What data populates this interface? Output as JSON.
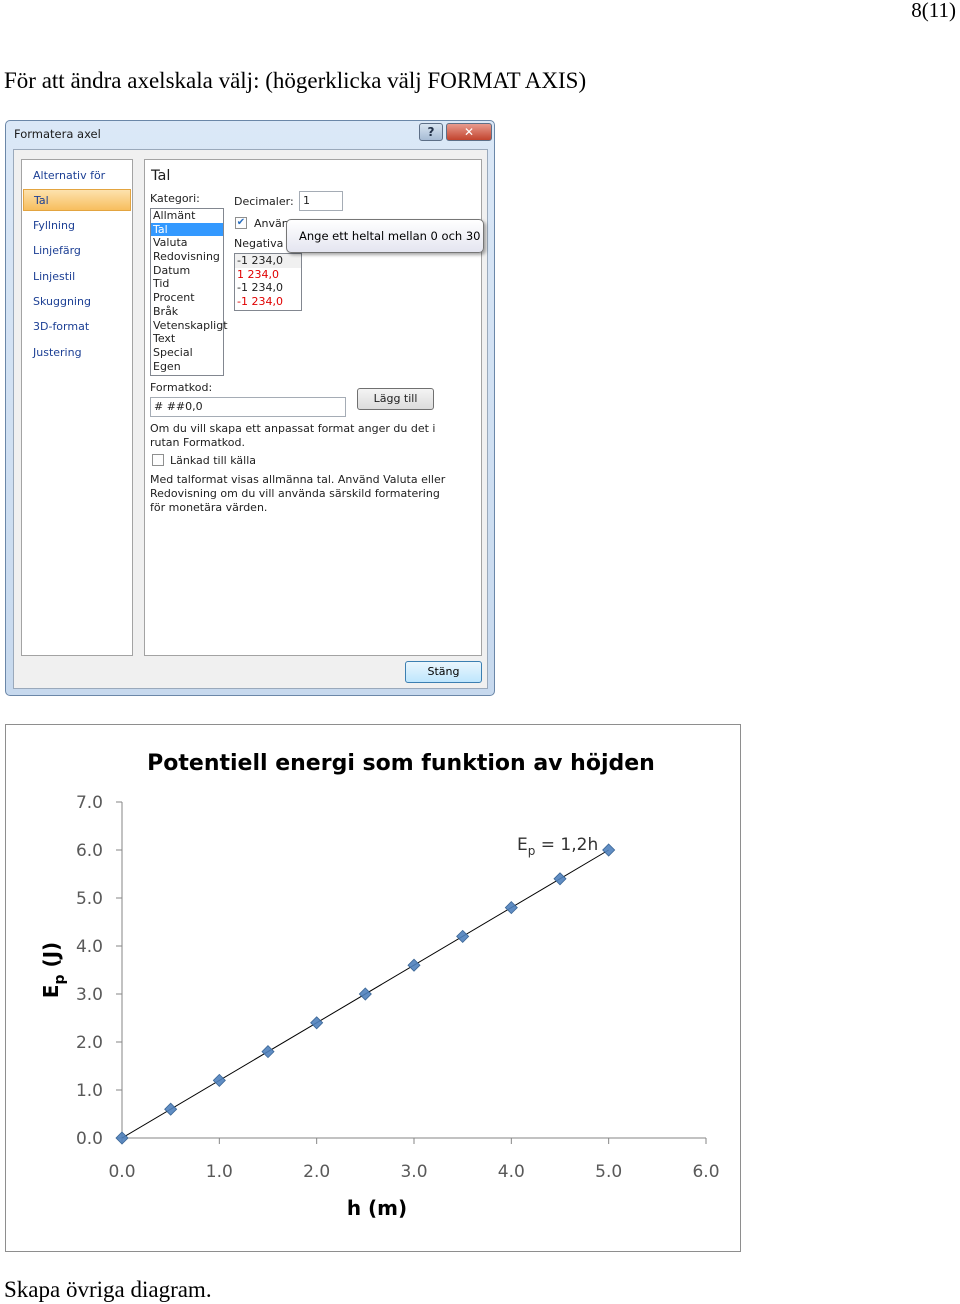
{
  "page_number": "8(11)",
  "intro_text": "För att ändra axelskala välj: (högerklicka välj FORMAT AXIS)",
  "outro_text": "Skapa övriga diagram.",
  "dialog": {
    "title": "Formatera axel",
    "help_icon": "question-icon",
    "close_icon": "close-icon",
    "nav_items": [
      "Alternativ för axel",
      "Tal",
      "Fyllning",
      "Linjefärg",
      "Linjestil",
      "Skuggning",
      "3D-format",
      "Justering"
    ],
    "selected_nav": "Tal",
    "panel_heading": "Tal",
    "kategori_label": "Kategori:",
    "kategori_items": [
      "Allmänt",
      "Tal",
      "Valuta",
      "Redovisning",
      "Datum",
      "Tid",
      "Procent",
      "Bråk",
      "Vetenskapligt",
      "Text",
      "Special",
      "Egen"
    ],
    "kategori_selected": "Tal",
    "decimaler_label": "Decimaler:",
    "decimaler_value": "1",
    "anvand_label": "Använd",
    "anvand_checked": true,
    "negativa_label": "Negativa t",
    "negativa_items": [
      "-1 234,0",
      "1 234,0",
      "-1 234,0",
      "-1 234,0"
    ],
    "tooltip": "Ange ett heltal mellan 0 och 30",
    "formatkod_label": "Formatkod:",
    "formatkod_value": "# ##0,0",
    "lagg_till_button": "Lägg till",
    "hint_text": "Om du vill skapa ett anpassat format anger du det i rutan Formatkod.",
    "lankad_label": "Länkad till källa",
    "lankad_checked": false,
    "info_text": "Med talformat visas allmänna tal. Använd Valuta eller Redovisning om du vill använda särskild formatering för monetära värden.",
    "stang_button": "Stäng"
  },
  "chart_data": {
    "type": "scatter",
    "title": "Potentiell energi som funktion av höjden",
    "xlabel": "h (m)",
    "ylabel": "Ep (J)",
    "ylabel_main": "E",
    "ylabel_sub": "p",
    "ylabel_rest": " (J)",
    "xlim": [
      0,
      6
    ],
    "ylim": [
      0,
      7
    ],
    "x_ticks": [
      "0.0",
      "1.0",
      "2.0",
      "3.0",
      "4.0",
      "5.0",
      "6.0"
    ],
    "y_ticks": [
      "0.0",
      "1.0",
      "2.0",
      "3.0",
      "4.0",
      "5.0",
      "6.0",
      "7.0"
    ],
    "grid": false,
    "marker_color": "#4f81bd",
    "series": [
      {
        "x": [
          0,
          0.5,
          1.0,
          1.5,
          2.0,
          2.5,
          3.0,
          3.5,
          4.0,
          4.5,
          5.0
        ],
        "y": [
          0,
          0.6,
          1.2,
          1.8,
          2.4,
          3.0,
          3.6,
          4.2,
          4.8,
          5.4,
          6.0
        ]
      }
    ],
    "trendline": {
      "slope": 1.2,
      "intercept": 0,
      "x_range": [
        0,
        5
      ]
    },
    "annotation": {
      "main": "E",
      "sub": "p",
      "rest": " = 1,2h"
    }
  }
}
